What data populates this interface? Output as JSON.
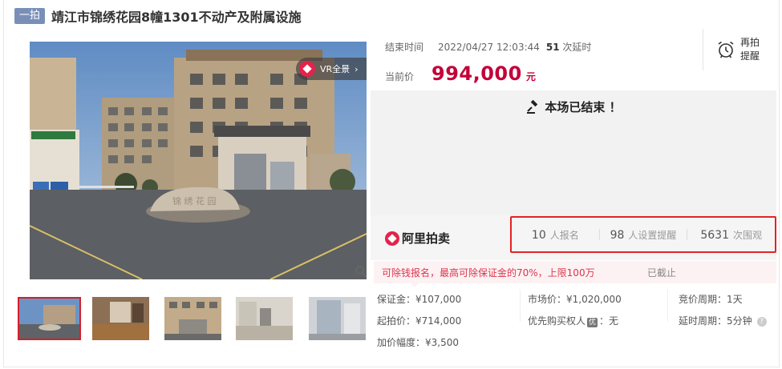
{
  "header": {
    "tag": "一拍",
    "title": "靖江市锦绣花园8幢1301不动产及附属设施"
  },
  "gallery": {
    "vr_label": "VR全景",
    "thumbnail_count": 5
  },
  "auction": {
    "end_time_label": "结束时间",
    "end_time": "2022/04/27 12:03:44",
    "delay_count": "51",
    "delay_label": "次延时",
    "price_label": "当前价",
    "price": "994,000",
    "price_unit": "元",
    "remind_line1": "再拍",
    "remind_line2": "提醒",
    "ended_message": "本场已结束 ！"
  },
  "stats": {
    "brand": "阿里拍卖",
    "signups": "10",
    "signups_label": "人报名",
    "reminders": "98",
    "reminders_label": "人设置提醒",
    "views": "5631",
    "views_label": "次围观"
  },
  "notice": {
    "text": "可除钱报名，最高可除保证金的70%，上限100万",
    "status": "已截止"
  },
  "details": {
    "deposit": "保证金：¥107,000",
    "start_price": "起拍价：¥714,000",
    "increment": "加价幅度：¥3,500",
    "market_price": "市场价：¥1,020,000",
    "priority_label": "优先购买权人",
    "priority_badge": "优",
    "priority_value": "：无",
    "cycle": "竞价周期：1天",
    "delay_cycle": "延时周期：5分钟",
    "help": "?"
  },
  "colors": {
    "price": "#c4003a",
    "highlight_border": "#e52222",
    "tag_bg": "#7a8fb8",
    "notice_text": "#d9364f"
  }
}
